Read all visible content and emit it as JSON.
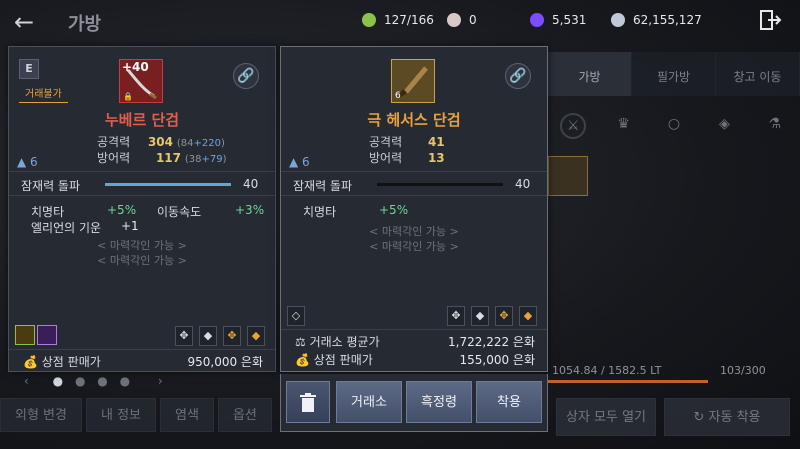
{
  "header": {
    "back_icon": "arrow-left-icon",
    "title": "가방"
  },
  "currencies": [
    {
      "icon": "energy-icon",
      "value": "127/166",
      "color": "#8bc34a"
    },
    {
      "icon": "pearl-icon",
      "value": "0",
      "color": "#d9c8c8"
    },
    {
      "icon": "crystal-icon",
      "value": "5,531",
      "color": "#7c4dff"
    },
    {
      "icon": "silver-icon",
      "value": "62,155,127",
      "color": "#c0c8d8"
    }
  ],
  "right_panel": {
    "tabs": [
      "가방",
      "필가방",
      "창고"
    ],
    "tab_badge": "창고 이동",
    "weight": "1054.84 / 1582.5 LT",
    "slots": "103/300",
    "open_all": "상자 모두 열기",
    "auto_equip": "자동 착용"
  },
  "bottom_left": [
    "외형 변경",
    "내 정보",
    "염색",
    "옵션"
  ],
  "card_left": {
    "badge": "E",
    "trade_tag": "거래불가",
    "enhance": "+40",
    "name": "누베르 단검",
    "name_color": "#e45c4c",
    "stats": [
      {
        "label": "공격력",
        "value": "304",
        "detail_a": "84",
        "detail_b": "+220"
      },
      {
        "label": "방어력",
        "value": "117",
        "detail_a": "38",
        "detail_b": "+79"
      }
    ],
    "level": "6",
    "potential": {
      "label": "잠재력 돌파",
      "value": "40",
      "fill": 1.0
    },
    "bonus": [
      {
        "label": "치명타",
        "value": "+5%"
      },
      {
        "label": "이동속도",
        "value": "+3%"
      },
      {
        "label": "엘리언의 기운",
        "value": "+1"
      }
    ],
    "engrave": [
      "< 마력각인 가능 >",
      "< 마력각인 가능 >"
    ],
    "sell_label": "상점 판매가",
    "sell_value": "950,000 은화"
  },
  "card_right": {
    "name": "극 헤서스 단검",
    "name_color": "#e8a23c",
    "enhance": "6",
    "stats": [
      {
        "label": "공격력",
        "value": "41"
      },
      {
        "label": "방어력",
        "value": "13"
      }
    ],
    "level": "6",
    "potential": {
      "label": "잠재력 돌파",
      "value": "40",
      "fill": 0.0
    },
    "bonus": [
      {
        "label": "치명타",
        "value": "+5%"
      }
    ],
    "engrave": [
      "< 마력각인 가능 >",
      "< 마력각인 가능 >"
    ],
    "market_label": "거래소 평균가",
    "market_value": "1,722,222 은화",
    "sell_label": "상점 판매가",
    "sell_value": "155,000 은화",
    "actions": [
      "거래소",
      "흑정령",
      "착용"
    ]
  }
}
